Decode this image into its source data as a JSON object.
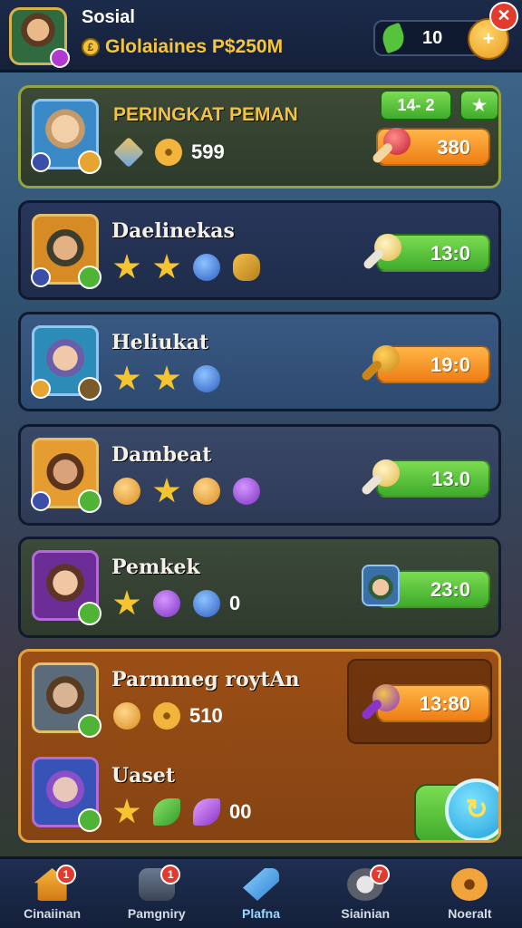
{
  "header": {
    "title": "Sosial",
    "subtitle": "Glolaiaines P$250M",
    "coin_symbol": "£",
    "currency_amount": "10",
    "add_icon": "plus-leaf-icon",
    "close_icon": "close-icon"
  },
  "rows": [
    {
      "name": "PERINGKAT PEMAN",
      "stat": "599",
      "score": "380",
      "tag_left": "14- 2",
      "tag_right": "★"
    },
    {
      "name": "Daelinekas",
      "score": "13:0"
    },
    {
      "name": "Heliukat",
      "score": "19:0"
    },
    {
      "name": "Dambeat",
      "score": "13.0"
    },
    {
      "name": "Pemkek",
      "stat": "0",
      "score": "23:0"
    },
    {
      "name": "Parmmeg roytAn",
      "stat": "510",
      "score": "13:80"
    },
    {
      "name": "Uaset",
      "stat": "00",
      "action_icon": "↻"
    }
  ],
  "nav": [
    {
      "label": "Cinaiinan",
      "badge": "1",
      "icon": "home-icon"
    },
    {
      "label": "Pamgniry",
      "badge": "1",
      "icon": "leaderboard-icon"
    },
    {
      "label": "Plafna",
      "badge": "",
      "icon": "play-arrow-icon"
    },
    {
      "label": "Siainian",
      "badge": "7",
      "icon": "social-icon"
    },
    {
      "label": "Noeralt",
      "badge": "",
      "icon": "settings-gear-icon"
    }
  ],
  "colors": {
    "accent_gold": "#f3c340",
    "score_orange": "#ee7e14",
    "score_green": "#3fab2b",
    "badge_red": "#e23b2e"
  }
}
